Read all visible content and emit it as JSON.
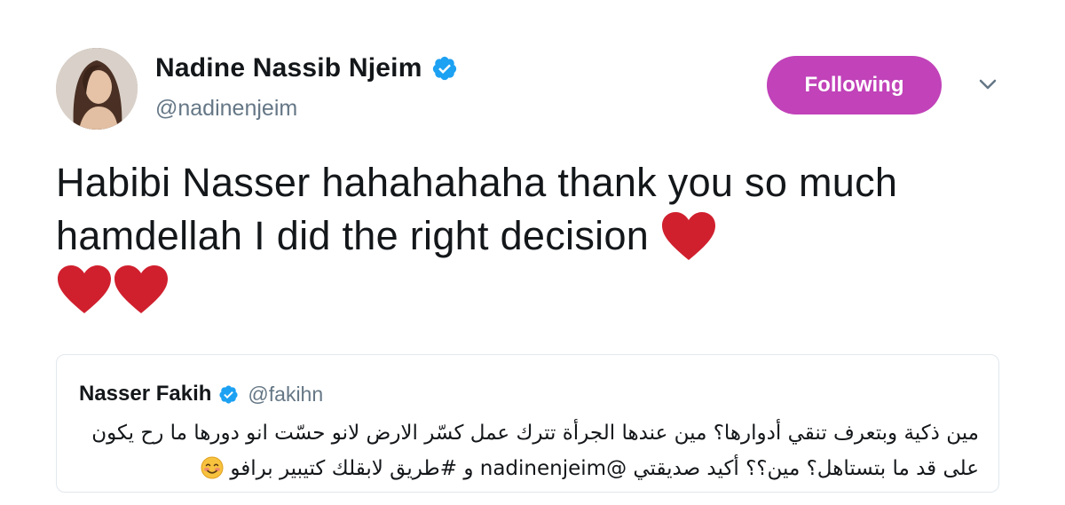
{
  "tweet": {
    "display_name": "Nadine Nassib Njeim",
    "handle": "@nadinenjeim",
    "follow_label": "Following",
    "text": "Habibi Nasser hahahahaha thank you so much hamdellah I did the right decision",
    "emoji_icons": [
      "red-heart-icon",
      "red-heart-icon",
      "red-heart-icon"
    ],
    "colors": {
      "follow_button": "#c142b9",
      "verified": "#1da1f2",
      "heart": "#d0202e",
      "handle": "#657786"
    }
  },
  "quoted_tweet": {
    "display_name": "Nasser Fakih",
    "handle": "@fakihn",
    "text": "مين ذكية وبتعرف تنقي أدوارها؟ مين عندها الجرأة تترك عمل كسّر الارض لانو حسّت انو دورها ما رح يكون على قد ما بتستاهل؟ مين؟؟ أكيد صديقتي @nadinenjeim و #طريق لابقلك كتيبير برافو",
    "emoji_icon": "smiling-face-icon"
  }
}
